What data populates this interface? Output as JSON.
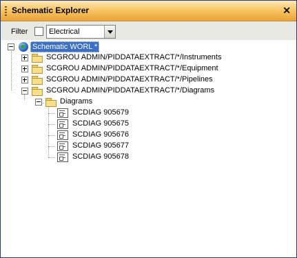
{
  "panel": {
    "title": "Schematic Explorer",
    "close_glyph": "✕"
  },
  "filter": {
    "label": "Filter",
    "checked": false,
    "selected": "Electrical"
  },
  "tree": {
    "root": {
      "label": "Schematic WORL *",
      "icon": "globe-icon"
    },
    "folders": [
      {
        "label": "SCGROU ADMIN/PIDDATAEXTRACT/*/Instruments",
        "expanded": false
      },
      {
        "label": "SCGROU ADMIN/PIDDATAEXTRACT/*/Equipment",
        "expanded": false
      },
      {
        "label": "SCGROU ADMIN/PIDDATAEXTRACT/*/Pipelines",
        "expanded": false
      },
      {
        "label": "SCGROU ADMIN/PIDDATAEXTRACT/*/Diagrams",
        "expanded": true
      }
    ],
    "subfolder": {
      "label": "Diagrams",
      "expanded": true
    },
    "diagrams": [
      "SCDIAG 905679",
      "SCDIAG 905675",
      "SCDIAG 905676",
      "SCDIAG 905677",
      "SCDIAG 905678"
    ]
  }
}
